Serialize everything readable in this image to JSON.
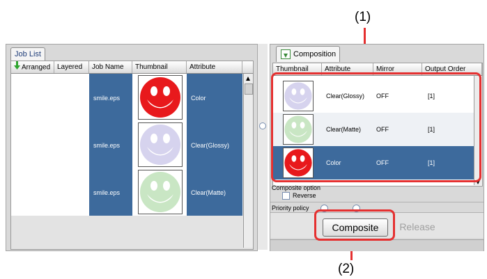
{
  "callouts": {
    "one": "(1)",
    "two": "(2)"
  },
  "job_list": {
    "tab_label": "Job List",
    "columns": [
      "Arranged",
      "Layered",
      "Job Name",
      "Thumbnail",
      "Attribute"
    ],
    "rows": [
      {
        "job_name": "smile.eps",
        "attribute": "Color",
        "thumb_color": "#e8191c"
      },
      {
        "job_name": "smile.eps",
        "attribute": "Clear(Glossy)",
        "thumb_color": "#d6d3ee"
      },
      {
        "job_name": "smile.eps",
        "attribute": "Clear(Matte)",
        "thumb_color": "#c9e6c4"
      }
    ]
  },
  "composition": {
    "tab_label": "Composition",
    "columns": [
      "Thumbnail",
      "Attribute",
      "Mirror",
      "Output Order"
    ],
    "rows": [
      {
        "attribute": "Clear(Glossy)",
        "mirror": "OFF",
        "order": "[1]",
        "thumb_color": "#d6d3ee"
      },
      {
        "attribute": "Clear(Matte)",
        "mirror": "OFF",
        "order": "[1]",
        "thumb_color": "#c9e6c4"
      },
      {
        "attribute": "Color",
        "mirror": "OFF",
        "order": "[1]",
        "thumb_color": "#e8191c"
      }
    ],
    "composite_option_label": "Composite option",
    "reverse_label": "Reverse",
    "priority_policy_label": "Priority policy",
    "composite_button": "Composite",
    "release_button": "Release"
  },
  "colors": {
    "accent_blue": "#3d6a9c",
    "callout_red": "#e53030"
  }
}
